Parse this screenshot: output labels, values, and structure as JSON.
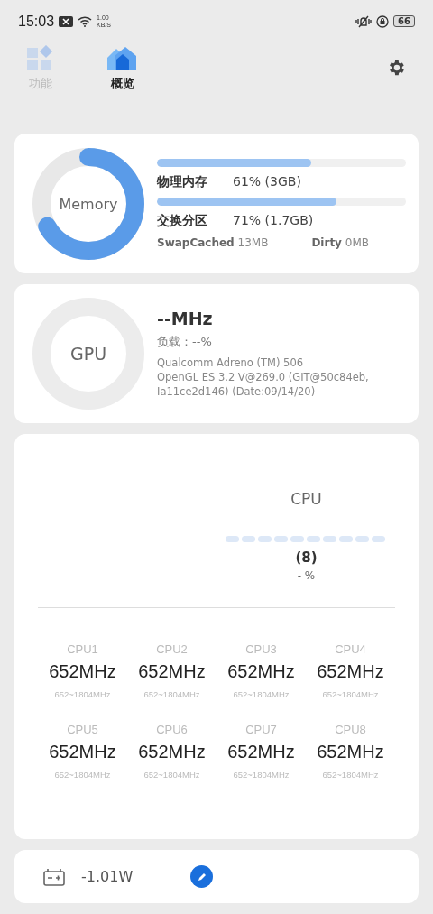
{
  "status_bar": {
    "time": "15:03",
    "net_speed_value": "1.00",
    "net_speed_unit": "KB/S",
    "battery": "66"
  },
  "tabs": [
    {
      "label": "功能",
      "selected": false,
      "kind": "grid"
    },
    {
      "label": "概览",
      "selected": true,
      "kind": "home"
    }
  ],
  "memory": {
    "ring_label": "Memory",
    "bars": [
      {
        "label": "物理内存",
        "reading": "61% (3GB)",
        "level": 0.62
      },
      {
        "label": "交换分区",
        "reading": "71% (1.7GB)",
        "level": 0.72
      }
    ],
    "stats": [
      {
        "label": "SwapCached",
        "value": "13MB"
      },
      {
        "label": "Dirty",
        "value": "0MB"
      }
    ]
  },
  "gpu": {
    "ring_label": "GPU",
    "frequency": "--MHz",
    "load": "负载：--%",
    "renderer": "Qualcomm Adreno (TM) 506",
    "version": "OpenGL ES 3.2 V@269.0 (GIT@50c84eb, Ia11ce2d146) (Date:09/14/20)"
  },
  "cpu": {
    "title": "CPU",
    "cores_count": "(8)",
    "load": "- %",
    "cores": [
      {
        "name": "CPU1",
        "frequency": "652MHz",
        "range": "652~1804MHz"
      },
      {
        "name": "CPU2",
        "frequency": "652MHz",
        "range": "652~1804MHz"
      },
      {
        "name": "CPU3",
        "frequency": "652MHz",
        "range": "652~1804MHz"
      },
      {
        "name": "CPU4",
        "frequency": "652MHz",
        "range": "652~1804MHz"
      },
      {
        "name": "CPU5",
        "frequency": "652MHz",
        "range": "652~1804MHz"
      },
      {
        "name": "CPU6",
        "frequency": "652MHz",
        "range": "652~1804MHz"
      },
      {
        "name": "CPU7",
        "frequency": "652MHz",
        "range": "652~1804MHz"
      },
      {
        "name": "CPU8",
        "frequency": "652MHz",
        "range": "652~1804MHz"
      }
    ]
  },
  "power": {
    "reading": "-1.01W"
  }
}
